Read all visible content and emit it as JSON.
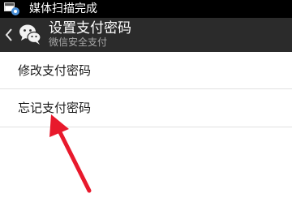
{
  "status_bar": {
    "notification_text": "媒体扫描完成",
    "icon": "media-scan-icon"
  },
  "header": {
    "title": "设置支付密码",
    "subtitle": "微信安全支付",
    "back_icon": "chevron-left-icon",
    "logo_icon": "wechat-logo-icon"
  },
  "menu": {
    "items": [
      {
        "label": "修改支付密码"
      },
      {
        "label": "忘记支付密码"
      }
    ]
  },
  "annotation": {
    "icon": "arrow-icon",
    "color": "#e8192c"
  },
  "colors": {
    "status_bar": "#000000",
    "title_bar": "#2b2b2b",
    "background": "#ffffff",
    "divider": "#e1e1e1"
  }
}
